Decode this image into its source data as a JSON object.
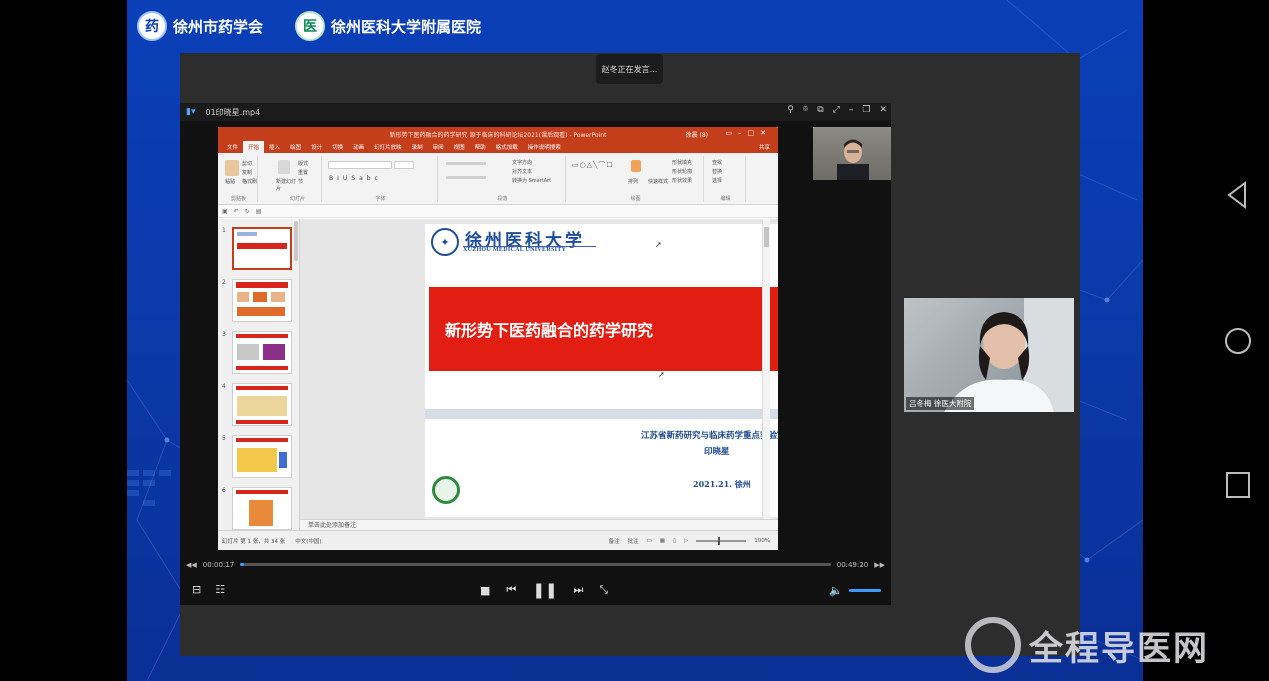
{
  "org_logos": [
    {
      "label": "徐州市药学会",
      "icon": "xuzhou-pharma-society-logo"
    },
    {
      "label": "徐州医科大学附属医院",
      "icon": "xuzhou-medical-hospital-logo"
    }
  ],
  "meeting": {
    "speaking_indicator": "赵冬正在发言..."
  },
  "player": {
    "file_name": "01印晓星.mp4",
    "current_time": "00:00:17",
    "total_time": "00:49:20",
    "progress": 0.006
  },
  "powerpoint": {
    "window_title": "新形势下医药融合的药学研究  源于临床的科研论坛2021(课后观看) - PowerPoint",
    "user": "徐晨 (8)",
    "tabs": [
      "文件",
      "开始",
      "插入",
      "绘图",
      "设计",
      "切换",
      "动画",
      "幻灯片放映",
      "录制",
      "审阅",
      "视图",
      "帮助",
      "格式加载",
      "操作说明搜索"
    ],
    "active_tab": "开始",
    "share": "共享",
    "ribbon_groups": [
      "剪贴板",
      "幻灯片",
      "字体",
      "段落",
      "绘图",
      "编辑"
    ],
    "ribbon_labels": {
      "paste": "粘贴",
      "new_slide": "新建幻灯片",
      "cut": "剪切",
      "copy": "复制",
      "format_painter": "格式刷",
      "layout": "版式",
      "reset": "重置",
      "section": "节",
      "text_direction": "文字方向",
      "align_text": "对齐文本",
      "smartart": "转换为 SmartArt",
      "arrange": "排列",
      "quick_styles": "快速样式",
      "shape_fill": "形状填充",
      "shape_outline": "形状轮廓",
      "shape_effects": "形状效果",
      "find": "查找",
      "replace": "替换",
      "select": "选择"
    },
    "slide_numbers": [
      "1",
      "2",
      "3",
      "4",
      "5",
      "6"
    ],
    "slide": {
      "university_cn": "徐州医科大学",
      "university_en": "XUZHOU MEDICAL UNIVERSITY",
      "title": "新形势下医药融合的药学研究",
      "lab": "江苏省新药研究与临床药学重点实验室",
      "author": "印晓星",
      "date": "2021.21.  徐州"
    },
    "notes_placeholder": "单击此处添加备注",
    "status": {
      "slide_info": "幻灯片 第 1 张，共 34 张",
      "language": "中文(中国)",
      "notes": "备注",
      "comments": "批注",
      "zoom": "100%"
    }
  },
  "participants": [
    {
      "name": "",
      "role": "camera-1"
    },
    {
      "name": "吕冬梅 徐医大附院",
      "role": "camera-2"
    }
  ],
  "watermark": "全程导医网",
  "colors": {
    "background_blue": "#0a3fb8",
    "ppt_accent": "#c43e1c",
    "slide_red": "#e21d12",
    "progress_blue": "#3c9cff"
  }
}
